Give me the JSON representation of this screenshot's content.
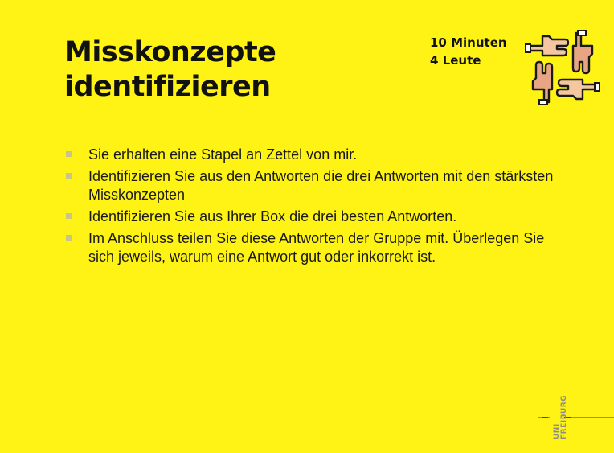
{
  "slide": {
    "title_line1": "Misskonzepte",
    "title_line2": "identifizieren",
    "duration": "10 Minuten",
    "group_size": "4 Leute",
    "icon": "hands-together-icon",
    "bullets": [
      "Sie erhalten eine Stapel an Zettel von mir.",
      "Identifizieren Sie aus den Antworten die drei Antworten mit den stärksten Misskonzepten",
      "Identifizieren Sie aus Ihrer Box die drei besten Antworten.",
      "Im Anschluss teilen Sie diese Antworten der Gruppe mit. Überlegen Sie sich jeweils, warum eine Antwort gut oder inkorrekt ist."
    ]
  },
  "logo": {
    "line1": "UNI",
    "line2": "FREIBURG"
  },
  "colors": {
    "background": "#fef314",
    "text": "#111111",
    "bullet": "#c9c48a",
    "logo_gray": "#8c8c8c",
    "logo_red": "#c8102e"
  }
}
